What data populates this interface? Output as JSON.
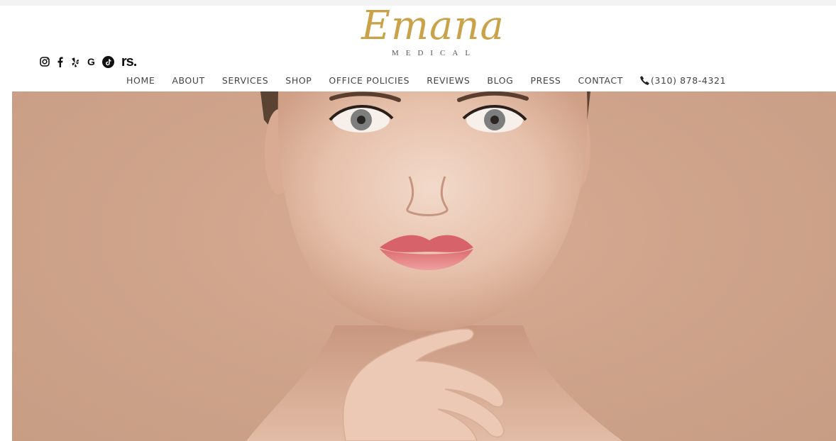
{
  "brand": {
    "script": "Emana",
    "sub": "MEDICAL",
    "gold": "#c9a24a"
  },
  "social": {
    "icons": [
      "instagram-icon",
      "facebook-icon",
      "yelp-icon",
      "google-icon",
      "tiktok-icon",
      "realself-icon"
    ],
    "google_label": "G",
    "realself_label": "rs."
  },
  "nav": {
    "items": [
      "HOME",
      "ABOUT",
      "SERVICES",
      "SHOP",
      "OFFICE POLICIES",
      "REVIEWS",
      "BLOG",
      "PRESS",
      "CONTACT"
    ],
    "phone": "(310) 878-4321"
  },
  "hero": {
    "background": "#cfa48b",
    "skin": "#e9c8b5",
    "lips": "#e0787b"
  }
}
